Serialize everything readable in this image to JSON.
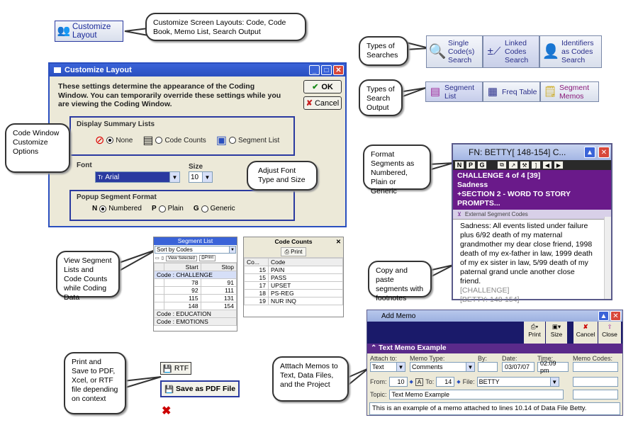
{
  "customize_button": {
    "label": "Customize Layout"
  },
  "callouts": {
    "customize": "Customize Screen Layouts: Code, Code Book, Memo List, Search Output",
    "types_searches": "Types of Searches",
    "types_search_output": "Types of Search Output",
    "code_window": "Code Window Customize Options",
    "font": "Adjust Font Type and Size",
    "format": "Format Segments as Numbered, Plain or Generic",
    "copy": "Copy and paste segments with footnotes",
    "view_segment": "View Segment Lists and Code Counts while Coding Data",
    "print_save": "Print and Save to PDF, Xcel, or RTF file depending on context",
    "memos": "Atttach Memos to Text, Data Files, and the Project"
  },
  "search_toolbar": [
    {
      "label": "Single Code(s) Search",
      "icon": "magnifier-icon"
    },
    {
      "label": "Linked Codes Search",
      "icon": "linked-codes-icon"
    },
    {
      "label": "Identifiers as Codes Search",
      "icon": "person-icon"
    }
  ],
  "output_toolbar": [
    {
      "label": "Segment List",
      "icon": "segment-list-icon"
    },
    {
      "label": "Freq Table",
      "icon": "freq-table-icon"
    },
    {
      "label": "Segment Memos",
      "icon": "memos-icon"
    }
  ],
  "dialog": {
    "title": "Customize Layout",
    "description": "These settings determine the appearance of the Coding Window. You can temporarily override these settings while you are viewing the Coding Window.",
    "ok": "OK",
    "cancel": "Cancel",
    "display_summary": "Display Summary Lists",
    "opt_none": "None",
    "opt_code_counts": "Code Counts",
    "opt_segment_list": "Segment List",
    "font_label": "Font",
    "font_value": "Arial",
    "size_label": "Size",
    "size_value": "10",
    "popup_label": "Popup Segment Format",
    "n": "N",
    "numbered": "Numbered",
    "p": "P",
    "plain": "Plain",
    "g": "G",
    "generic": "Generic"
  },
  "coding_window": {
    "title": "FN: BETTY[ 148-154]   C...",
    "btn_n": "N",
    "btn_p": "P",
    "btn_g": "G",
    "challenge": "CHALLENGE   4 of 4 [39]",
    "sadness": "Sadness",
    "section": "+SECTION 2 - WORD TO STORY PROMPTS...",
    "external": "External Segment Codes",
    "body": "Sadness:  All events listed under failure plus 6/92 death of my maternal grandmother my dear close friend, 1998 death of my ex-father in law, 1999 death of my ex sister in law, 5/99 death of my paternal grand uncle another close friend.",
    "foot1": "[CHALLENGE]",
    "foot2": "[BETTY: 148-154]"
  },
  "segment_list": {
    "title": "Segment List",
    "sort": "Sort by Codes",
    "view_selected": "View Selected",
    "print": "Print",
    "col_start": "Start",
    "col_stop": "Stop",
    "group1": "Code : CHALLENGE",
    "rows": [
      [
        "78",
        "91"
      ],
      [
        "92",
        "111"
      ],
      [
        "115",
        "131"
      ],
      [
        "148",
        "154"
      ]
    ],
    "group2": "Code : EDUCATION",
    "group3": "Code : EMOTIONS"
  },
  "code_counts": {
    "title": "Code Counts",
    "print": "Print",
    "col_count": "Co...",
    "col_code": "Code",
    "rows": [
      [
        "15",
        "PAIN"
      ],
      [
        "15",
        "PASS"
      ],
      [
        "17",
        "UPSET"
      ],
      [
        "18",
        "PS-REG"
      ],
      [
        "19",
        "NUR INQ"
      ]
    ]
  },
  "buttons": {
    "rtf": "RTF",
    "pdf": "Save as PDF File"
  },
  "memo": {
    "title": "Add Memo",
    "print": "Print",
    "size": "Size",
    "cancel": "Cancel",
    "close": "Close",
    "section": "Text Memo Example",
    "attach_to_lbl": "Attach to:",
    "attach_to": "Text",
    "memo_type_lbl": "Memo Type:",
    "memo_type": "Comments",
    "by_lbl": "By:",
    "date_lbl": "Date:",
    "date": "03/07/07",
    "time_lbl": "Time:",
    "time": "02:09 pm",
    "codes_lbl": "Memo Codes:",
    "from_lbl": "From:",
    "from": "10",
    "to_lbl": "To:",
    "to": "14",
    "file_lbl": "File:",
    "file": "BETTY",
    "topic_lbl": "Topic:",
    "topic": "Text Memo Example",
    "body": "This is an example of a memo attached to lines 10.14 of Data File Betty."
  }
}
